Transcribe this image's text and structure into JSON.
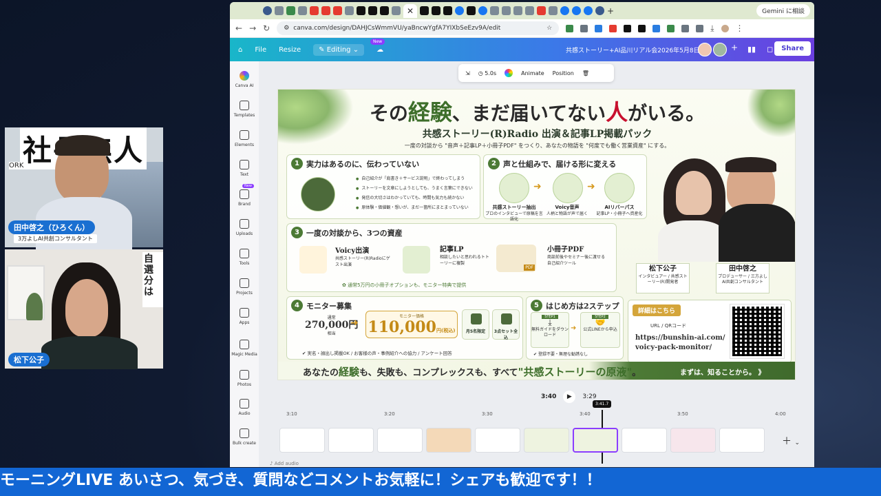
{
  "participants": [
    {
      "name": "田中啓之（ひろくん）",
      "subtitle": "3万よしAI共創コンサルタント",
      "bg_text": "社長無人",
      "bg_side": "ORK"
    },
    {
      "name": "松下公子"
    }
  ],
  "browser": {
    "gemini_label": "Gemini に相談",
    "url": "canva.com/design/DAHJCsWmmVU/yaBncwYgfA7YIXbSeEzv9A/edit"
  },
  "canva": {
    "menu": {
      "file": "File",
      "resize": "Resize",
      "editing": "Editing",
      "new_badge": "New"
    },
    "doc_title": "共感ストーリー+AI品川リアル会2026年5月8日",
    "share": "Share",
    "sidebar": [
      {
        "label": "Canva AI"
      },
      {
        "label": "Templates"
      },
      {
        "label": "Elements"
      },
      {
        "label": "Text"
      },
      {
        "label": "Brand",
        "badge": "New"
      },
      {
        "label": "Uploads"
      },
      {
        "label": "Tools"
      },
      {
        "label": "Projects"
      },
      {
        "label": "Apps"
      },
      {
        "label": "Magic Media"
      },
      {
        "label": "Photos"
      },
      {
        "label": "Audio"
      },
      {
        "label": "Bulk create"
      }
    ],
    "floatbar": {
      "duration": "5.0s",
      "animate": "Animate",
      "position": "Position"
    },
    "playback": {
      "current": "3:40",
      "total": "3:29",
      "scrub": "3:41.7"
    },
    "ruler": [
      "3:10",
      "3:20",
      "3:30",
      "3:40",
      "3:50",
      "4:00"
    ],
    "add_audio": "Add audio"
  },
  "slide": {
    "title_pre": "その",
    "title_hl1": "経験",
    "title_mid": "、まだ届いてない",
    "title_hl2": "人",
    "title_post": "がいる。",
    "subtitle": "共感ストーリー(R)Radio 出演＆記事LP掲載パック",
    "lead": "一度の対談から \"音声＋記事LP＋小冊子PDF\" をつくり、あなたの物語を \"何度でも働く営業資産\" にする。",
    "p1": {
      "num": "1",
      "title": "実力はあるのに、伝わっていない",
      "bullets": [
        "自己紹介が「肩書き＋サービス説明」で終わってしまう",
        "ストーリーを文章にしようとしても、うまく言葉にできない",
        "発信の大切さはわかっていても、時間も気力も続かない",
        "原体験・価値観・想いが、まだ一箇所にまとまっていない"
      ]
    },
    "p2": {
      "num": "2",
      "title": "声と仕組みで、届ける形に変える",
      "steps": [
        {
          "title": "共感ストーリー抽出",
          "desc": "プロのインタビューで原稿を言語化"
        },
        {
          "title": "Voicy音声",
          "desc": "人柄と物語が声で届く"
        },
        {
          "title": "AIリバーパス",
          "desc": "記事LP・小冊子へ資産化"
        }
      ]
    },
    "p3": {
      "num": "3",
      "title": "一度の対談から、3つの資産",
      "assets": [
        {
          "title": "Voicy出演",
          "desc": "共感ストーリー(R)Radioにゲスト出演"
        },
        {
          "title": "記事LP",
          "desc": "相談したいと思われるトトーリーに複製"
        },
        {
          "title": "小冊子PDF",
          "desc": "商談前後やセミナー後に渡せる自己紹介ツール"
        }
      ],
      "note": "通常5万円の小冊子オプションも、モニター特典で提供",
      "pdf_label": "PDF"
    },
    "p4": {
      "num": "4",
      "title": "モニター募集",
      "normal_label": "通常",
      "normal_price": "270,000円",
      "normal_suffix": "相当",
      "monitor_label": "モニター価格",
      "monitor_price": "110,000",
      "monitor_unit": "円(税込)",
      "chip1": "月5名限定",
      "chip2": "3点セット全込",
      "footer": "実名・顔出し掲載OK / お客様の声・事例紹介への協力 / アンケート回答"
    },
    "p5": {
      "num": "5",
      "title": "はじめ方は2ステップ",
      "step1_tag": "STEP1",
      "step1": "無料ガイドをダウンロード",
      "step2_tag": "STEP2",
      "step2": "公式LINEから申込",
      "footer": "登録不要・無理な勧誘なし"
    },
    "people": [
      {
        "name": "松下公子",
        "role": "インタビュアー / 共感ストーリー(R)開発者"
      },
      {
        "name": "田中啓之",
        "role": "プロデューサー / 三方よしAI共創コンサルタント"
      }
    ],
    "detail": {
      "badge": "詳細はこちら",
      "label": "URL / QRコード",
      "url1": "https://bunshin-ai.com/",
      "url2": "voicy-pack-monitor/"
    },
    "bottom_pre": "あなたの",
    "bottom_hl1": "経験",
    "bottom_mid": "も、失敗も、コンプレックスも、すべて",
    "bottom_hl2": "\"共感ストーリーの原液\"",
    "bottom_post": "。",
    "cta": "まずは、知ることから。 》"
  },
  "ticker": "モーニングLIVE あいさつ、気づき、質問などコメントお気軽に！シェアも歓迎です！！"
}
